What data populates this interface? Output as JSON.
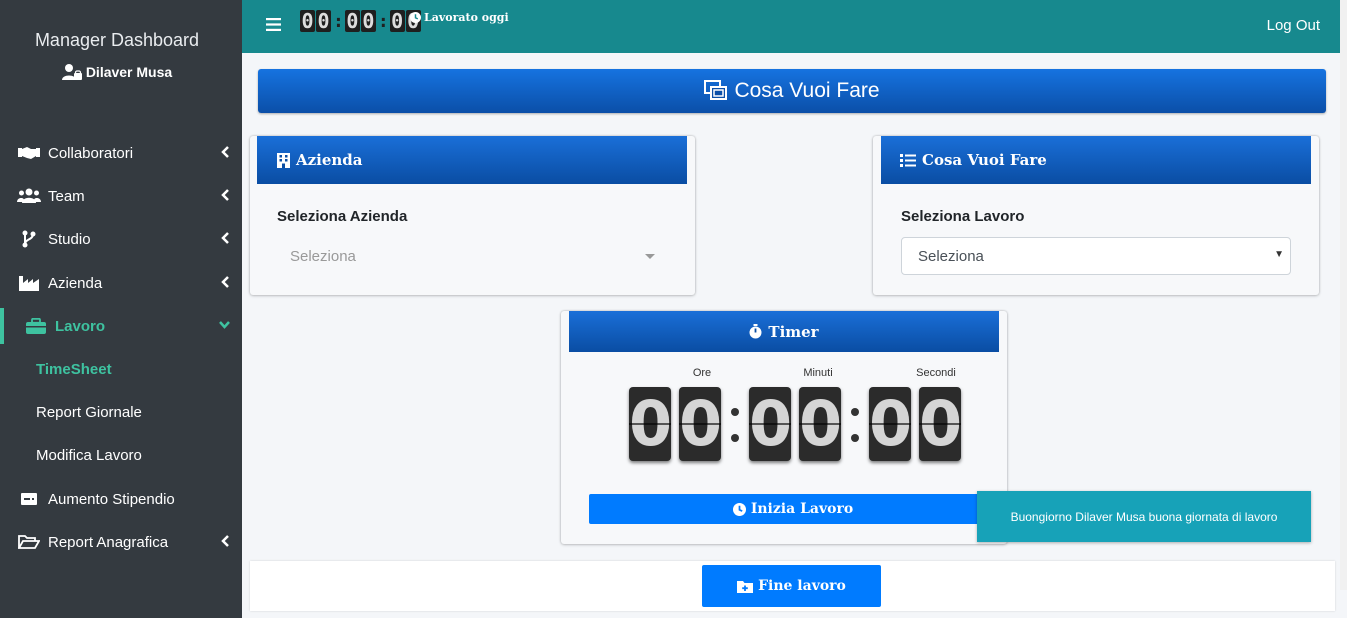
{
  "sidebar": {
    "brand": "Manager Dashboard",
    "user_name": "Dilaver Musa",
    "items": [
      {
        "label": "Collaboratori",
        "icon": "handshake-icon"
      },
      {
        "label": "Team",
        "icon": "users-icon"
      },
      {
        "label": "Studio",
        "icon": "code-branch-icon"
      },
      {
        "label": "Azienda",
        "icon": "industry-icon"
      },
      {
        "label": "Lavoro",
        "icon": "briefcase-icon"
      },
      {
        "label": "Aumento Stipendio",
        "icon": "money-bill-icon"
      },
      {
        "label": "Report Anagrafica",
        "icon": "folder-open-icon"
      }
    ],
    "subitems": [
      {
        "label": "TimeSheet"
      },
      {
        "label": "Report Giornale"
      },
      {
        "label": "Modifica Lavoro"
      }
    ]
  },
  "topbar": {
    "clock": [
      "0",
      "0",
      "0",
      "0",
      "0",
      "0"
    ],
    "worked_label": "Lavorato oggi",
    "logout": "Log Out"
  },
  "banner": {
    "title": "Cosa Vuoi Fare"
  },
  "azienda_card": {
    "title": "Azienda",
    "field_label": "Seleziona Azienda",
    "select_value": "Seleziona"
  },
  "lavoro_card": {
    "title": "Cosa Vuoi Fare",
    "field_label": "Seleziona Lavoro",
    "select_value": "Seleziona"
  },
  "timer_card": {
    "title": "Timer",
    "labels": {
      "hours": "Ore",
      "minutes": "Minuti",
      "seconds": "Secondi"
    },
    "digits": [
      "0",
      "0",
      "0",
      "0",
      "0",
      "0"
    ],
    "start_button": "Inizia Lavoro"
  },
  "toast": {
    "message": "Buongiorno Dilaver Musa buona giornata di lavoro"
  },
  "footer": {
    "end_button": "Fine lavoro"
  },
  "colors": {
    "sidebar_bg": "#343a40",
    "topbar_bg": "#17898e",
    "accent": "#3ec2a0",
    "primary": "#007bff",
    "toast": "#17a2b8"
  }
}
